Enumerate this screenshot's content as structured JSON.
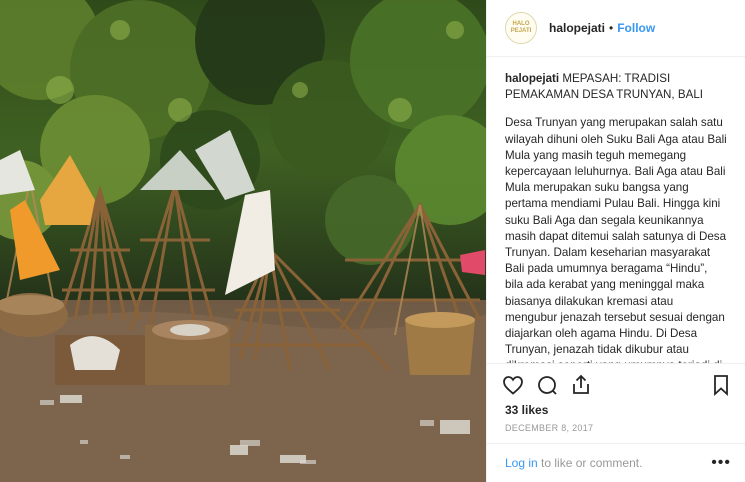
{
  "header": {
    "avatar_text": "HALO PEJATI",
    "username": "halopejati",
    "separator": "•",
    "follow_label": "Follow"
  },
  "caption": {
    "username": "halopejati",
    "title": "MEPASAH: TRADISI PEMAKAMAN DESA TRUNYAN, BALI",
    "body": "Desa Trunyan yang merupakan salah satu wilayah dihuni oleh Suku Bali Aga atau Bali Mula yang masih teguh memegang kepercayaan leluhurnya. Bali Aga atau Bali Mula merupakan suku bangsa yang pertama mendiami Pulau Bali. Hingga kini suku Bali Aga dan segala keunikannya masih dapat ditemui salah satunya di Desa Trunyan. Dalam keseharian masyarakat Bali pada umumnya beragama “Hindu”, bila ada kerabat yang meninggal maka biasanya dilakukan kremasi atau mengubur jenazah tersebut sesuai dengan diajarkan oleh agama Hindu. Di Desa Trunyan, jenazah tidak dikubur atau dikremasi seperti yang umumnya terjadi di wilayah lainnya, masyarakat Desa Trunyan menyimpan"
  },
  "actions": {
    "icons": [
      "heart-icon",
      "comment-icon",
      "share-icon",
      "bookmark-icon"
    ]
  },
  "likes": "33 likes",
  "date": "DECEMBER 8, 2017",
  "comment_bar": {
    "login_label": "Log in",
    "rest_label": " to like or comment.",
    "more_label": "•••"
  },
  "colors": {
    "link": "#3897f0",
    "text": "#262626",
    "muted": "#999999"
  }
}
